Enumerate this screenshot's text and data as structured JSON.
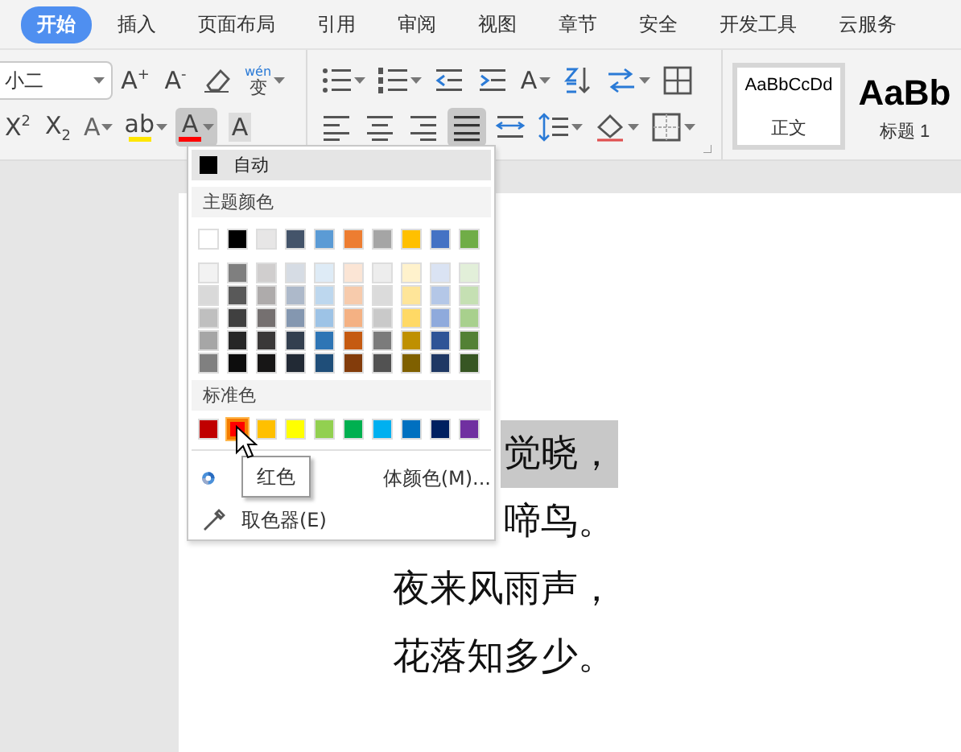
{
  "tabs": [
    {
      "label": "开始",
      "selected": true
    },
    {
      "label": "插入",
      "selected": false
    },
    {
      "label": "页面布局",
      "selected": false
    },
    {
      "label": "引用",
      "selected": false
    },
    {
      "label": "审阅",
      "selected": false
    },
    {
      "label": "视图",
      "selected": false
    },
    {
      "label": "章节",
      "selected": false
    },
    {
      "label": "安全",
      "selected": false
    },
    {
      "label": "开发工具",
      "selected": false
    },
    {
      "label": "云服务",
      "selected": false
    }
  ],
  "font_row_1": [
    {
      "kind": "field",
      "value": "小二"
    },
    {
      "kind": "text",
      "label": "A$^{+}$",
      "pressed": false
    },
    {
      "kind": "text",
      "label": "A$^{-}$",
      "pressed": false
    },
    {
      "kind": "eraser",
      "pressed": false
    },
    {
      "kind": "pinyin",
      "label": "wén",
      "base": "变",
      "pressed": false
    }
  ],
  "font_row_2": [
    {
      "kind": "text",
      "label": "X$^{2}$",
      "pressed": false
    },
    {
      "kind": "text",
      "label": "X$_{2}$",
      "pressed": false
    },
    {
      "kind": "effect",
      "label": "A",
      "pressed": false
    },
    {
      "kind": "underlined",
      "label": "ab",
      "color": "#ffe600",
      "pressed": false
    },
    {
      "kind": "underlined",
      "label": "A",
      "color": "#ff0000",
      "pressed": true
    },
    {
      "kind": "shade",
      "label": "A",
      "pressed": false
    }
  ],
  "para_row_1": [
    {
      "kind": "bullets",
      "pressed": false
    },
    {
      "kind": "numbering",
      "pressed": false
    },
    {
      "kind": "outdent",
      "pressed": false
    },
    {
      "kind": "indent",
      "pressed": false
    },
    {
      "kind": "direction",
      "label": "A",
      "pressed": false
    },
    {
      "kind": "sort",
      "pressed": false
    },
    {
      "kind": "swap",
      "pressed": false
    },
    {
      "kind": "table",
      "pressed": false
    }
  ],
  "para_row_2": [
    {
      "kind": "align-left",
      "pressed": false
    },
    {
      "kind": "align-center",
      "pressed": false
    },
    {
      "kind": "align-right",
      "pressed": false
    },
    {
      "kind": "justify",
      "pressed": true
    },
    {
      "kind": "distribute",
      "pressed": false
    },
    {
      "kind": "spacing",
      "pressed": false
    },
    {
      "kind": "fill",
      "pressed": false
    },
    {
      "kind": "borders",
      "pressed": false
    }
  ],
  "styles": [
    {
      "sample": "AaBbCcDd",
      "name": "正文",
      "selected": true
    },
    {
      "sample": "AaBb",
      "name": "标题 1",
      "selected": false
    }
  ],
  "color_menu": {
    "auto": {
      "label": "自动",
      "color": "#000000"
    },
    "theme_title": "主题颜色",
    "theme": [
      {
        "color": "#ffffff",
        "selected": false
      },
      {
        "color": "#000000",
        "selected": false
      },
      {
        "color": "#e7e6e6",
        "selected": false
      },
      {
        "color": "#44546a",
        "selected": false
      },
      {
        "color": "#5b9bd5",
        "selected": false
      },
      {
        "color": "#ed7d31",
        "selected": false
      },
      {
        "color": "#a5a5a5",
        "selected": false
      },
      {
        "color": "#ffc000",
        "selected": false
      },
      {
        "color": "#4472c4",
        "selected": false
      },
      {
        "color": "#70ad47",
        "selected": false
      }
    ],
    "shades": [
      [
        {
          "color": "#f2f2f2",
          "selected": false
        },
        {
          "color": "#7f7f7f",
          "selected": false
        },
        {
          "color": "#d0cece",
          "selected": false
        },
        {
          "color": "#d6dce4",
          "selected": false
        },
        {
          "color": "#deebf6",
          "selected": false
        },
        {
          "color": "#fbe5d5",
          "selected": false
        },
        {
          "color": "#ededed",
          "selected": false
        },
        {
          "color": "#fff2cc",
          "selected": false
        },
        {
          "color": "#dae3f3",
          "selected": false
        },
        {
          "color": "#e2efd9",
          "selected": false
        }
      ],
      [
        {
          "color": "#d9d9d9",
          "selected": false
        },
        {
          "color": "#595959",
          "selected": false
        },
        {
          "color": "#aeabab",
          "selected": false
        },
        {
          "color": "#adb9ca",
          "selected": false
        },
        {
          "color": "#bdd7ee",
          "selected": false
        },
        {
          "color": "#f7cbac",
          "selected": false
        },
        {
          "color": "#dbdbdb",
          "selected": false
        },
        {
          "color": "#fee599",
          "selected": false
        },
        {
          "color": "#b4c7e7",
          "selected": false
        },
        {
          "color": "#c5e0b3",
          "selected": false
        }
      ],
      [
        {
          "color": "#bfbfbf",
          "selected": false
        },
        {
          "color": "#404040",
          "selected": false
        },
        {
          "color": "#757070",
          "selected": false
        },
        {
          "color": "#8497b0",
          "selected": false
        },
        {
          "color": "#9dc3e6",
          "selected": false
        },
        {
          "color": "#f4b183",
          "selected": false
        },
        {
          "color": "#c9c9c9",
          "selected": false
        },
        {
          "color": "#ffd965",
          "selected": false
        },
        {
          "color": "#8faadc",
          "selected": false
        },
        {
          "color": "#a8d08d",
          "selected": false
        }
      ],
      [
        {
          "color": "#a6a6a6",
          "selected": false
        },
        {
          "color": "#262626",
          "selected": false
        },
        {
          "color": "#3a3838",
          "selected": false
        },
        {
          "color": "#333f4f",
          "selected": false
        },
        {
          "color": "#2e75b5",
          "selected": false
        },
        {
          "color": "#c55a11",
          "selected": false
        },
        {
          "color": "#7b7b7b",
          "selected": false
        },
        {
          "color": "#bf9000",
          "selected": false
        },
        {
          "color": "#2f5496",
          "selected": false
        },
        {
          "color": "#538135",
          "selected": false
        }
      ],
      [
        {
          "color": "#808080",
          "selected": false
        },
        {
          "color": "#0d0d0d",
          "selected": false
        },
        {
          "color": "#171616",
          "selected": false
        },
        {
          "color": "#222a35",
          "selected": false
        },
        {
          "color": "#1f4e79",
          "selected": false
        },
        {
          "color": "#833c0b",
          "selected": false
        },
        {
          "color": "#525252",
          "selected": false
        },
        {
          "color": "#7f6000",
          "selected": false
        },
        {
          "color": "#1f3864",
          "selected": false
        },
        {
          "color": "#375623",
          "selected": false
        }
      ]
    ],
    "standard_title": "标准色",
    "standard": [
      {
        "color": "#c00000",
        "selected": false
      },
      {
        "color": "#ff0000",
        "selected": true
      },
      {
        "color": "#ffc000",
        "selected": false
      },
      {
        "color": "#ffff00",
        "selected": false
      },
      {
        "color": "#92d050",
        "selected": false
      },
      {
        "color": "#00b050",
        "selected": false
      },
      {
        "color": "#00b0f0",
        "selected": false
      },
      {
        "color": "#0070c0",
        "selected": false
      },
      {
        "color": "#002060",
        "selected": false
      },
      {
        "color": "#7030a0",
        "selected": false
      }
    ],
    "items": [
      {
        "kind": "more",
        "label": "体颜色(M)..."
      },
      {
        "kind": "picker",
        "label": "取色器(E)"
      }
    ]
  },
  "tooltip": "红色",
  "poem": [
    {
      "text": "觉晓，",
      "highlighted": true
    },
    {
      "text": "啼鸟。",
      "highlighted": false
    },
    {
      "text": "夜来风雨声，",
      "highlighted": false
    },
    {
      "text": "花落知多少。",
      "highlighted": false
    }
  ]
}
